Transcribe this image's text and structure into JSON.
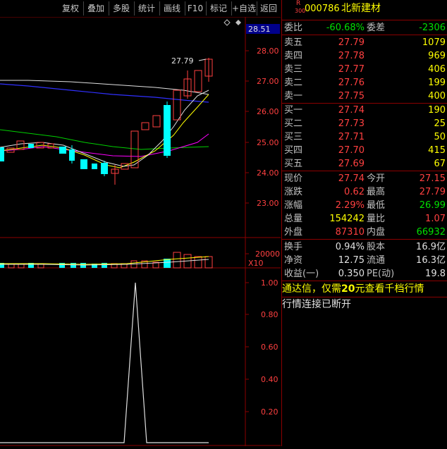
{
  "toolbar": {
    "buttons": [
      "复权",
      "叠加",
      "多股",
      "统计",
      "画线",
      "F10",
      "标记",
      "+自选",
      "返回"
    ]
  },
  "chart": {
    "price_axis": [
      "28.00",
      "27.00",
      "26.00",
      "25.00",
      "24.00",
      "23.00"
    ],
    "last_price_tag": "28.51",
    "high_label": "27.79",
    "vol_axis": "20000",
    "vol_mult": "X10",
    "ind_axis": [
      "1.00",
      "0.80",
      "0.60",
      "0.40",
      "0.20"
    ]
  },
  "quote": {
    "r_badge": "R",
    "r_num": "300",
    "code": "000786",
    "name": "北新建材",
    "weibi_label": "委比",
    "weibi_value": "-60.68%",
    "weicha_label": "委差",
    "weicha_value": "-2306",
    "asks": [
      {
        "label": "卖五",
        "price": "27.79",
        "vol": "1079"
      },
      {
        "label": "卖四",
        "price": "27.78",
        "vol": "969"
      },
      {
        "label": "卖三",
        "price": "27.77",
        "vol": "406"
      },
      {
        "label": "卖二",
        "price": "27.76",
        "vol": "199"
      },
      {
        "label": "卖一",
        "price": "27.75",
        "vol": "400"
      }
    ],
    "bids": [
      {
        "label": "买一",
        "price": "27.74",
        "vol": "190"
      },
      {
        "label": "买二",
        "price": "27.73",
        "vol": "25"
      },
      {
        "label": "买三",
        "price": "27.71",
        "vol": "50"
      },
      {
        "label": "买四",
        "price": "27.70",
        "vol": "415"
      },
      {
        "label": "买五",
        "price": "27.69",
        "vol": "67"
      }
    ],
    "stats": [
      {
        "l1": "现价",
        "v1": "27.74",
        "l2": "今开",
        "v2": "27.15"
      },
      {
        "l1": "涨跌",
        "v1": "0.62",
        "l2": "最高",
        "v2": "27.79"
      },
      {
        "l1": "涨幅",
        "v1": "2.29%",
        "l2": "最低",
        "v2": "26.99"
      },
      {
        "l1": "总量",
        "v1": "154242",
        "l2": "量比",
        "v2": "1.07"
      },
      {
        "l1": "外盘",
        "v1": "87310",
        "l2": "内盘",
        "v2": "66932"
      }
    ],
    "fund": [
      {
        "l1": "换手",
        "v1": "0.94%",
        "l2": "股本",
        "v2": "16.9亿"
      },
      {
        "l1": "净资",
        "v1": "12.75",
        "l2": "流通",
        "v2": "16.3亿"
      },
      {
        "l1": "收益(一)",
        "v1": "0.350",
        "l2": "PE(动)",
        "v2": "19.8"
      }
    ],
    "ad_text_1": "通达信，仅需",
    "ad_price": "20",
    "ad_text_2": "元查看千档行情",
    "conn_text": "行情连接已断开"
  },
  "colors": {
    "up": "#ff4040",
    "down": "#00ffff",
    "border": "#8b0000"
  }
}
